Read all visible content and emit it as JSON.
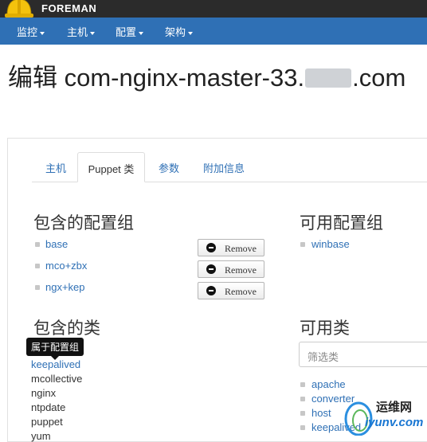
{
  "header": {
    "brand": "FOREMAN"
  },
  "nav": {
    "items": [
      "监控",
      "主机",
      "配置",
      "架构"
    ]
  },
  "page": {
    "title_prefix": "编辑 com-nginx-master-33.",
    "title_suffix": ".com"
  },
  "tabs": [
    "主机",
    "Puppet 类",
    "参数",
    "附加信息"
  ],
  "config_groups": {
    "included_title": "包含的配置组",
    "available_title": "可用配置组",
    "included": [
      "base",
      "mco+zbx",
      "ngx+kep"
    ],
    "remove_label": "Remove",
    "available": [
      "winbase"
    ]
  },
  "classes": {
    "included_title": "包含的类",
    "available_title": "可用类",
    "tooltip": "属于配置组",
    "included": [
      "keepalived",
      "mcollective",
      "nginx",
      "ntpdate",
      "puppet",
      "yum"
    ],
    "filter_placeholder": "筛选类",
    "available": [
      "apache",
      "converter",
      "host",
      "keepalived"
    ]
  },
  "watermark": {
    "line1": "运维网",
    "line2": "iyunv.com"
  },
  "colors": {
    "navbar": "#2f70b5",
    "topbar": "#2b2b2b",
    "link": "#2f70b5",
    "helmet": "#f4c20d"
  }
}
